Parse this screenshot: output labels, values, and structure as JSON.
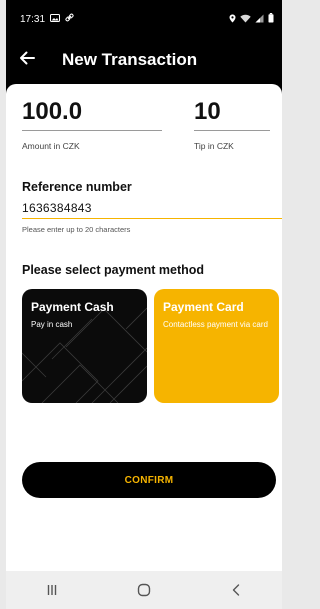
{
  "status_bar": {
    "time": "17:31"
  },
  "app_bar": {
    "title": "New Transaction"
  },
  "amount": {
    "value": "100.0",
    "label": "Amount in CZK"
  },
  "tip": {
    "value": "10",
    "label": "Tip in CZK"
  },
  "reference": {
    "title": "Reference number",
    "value": "1636384843",
    "hint": "Please enter up to 20 characters"
  },
  "payment": {
    "title": "Please select payment method",
    "cash": {
      "title": "Payment Cash",
      "subtitle": "Pay in cash"
    },
    "card": {
      "title": "Payment Card",
      "subtitle": "Contactless payment via card"
    }
  },
  "confirm_label": "CONFIRM",
  "colors": {
    "accent": "#f6b400",
    "dark": "#000000",
    "surface": "#ffffff"
  },
  "icons": [
    "gallery-icon",
    "link-icon",
    "location-icon",
    "wifi-icon",
    "signal-icon",
    "battery-icon",
    "back-arrow-icon",
    "recents-icon",
    "home-icon",
    "nav-back-icon"
  ]
}
